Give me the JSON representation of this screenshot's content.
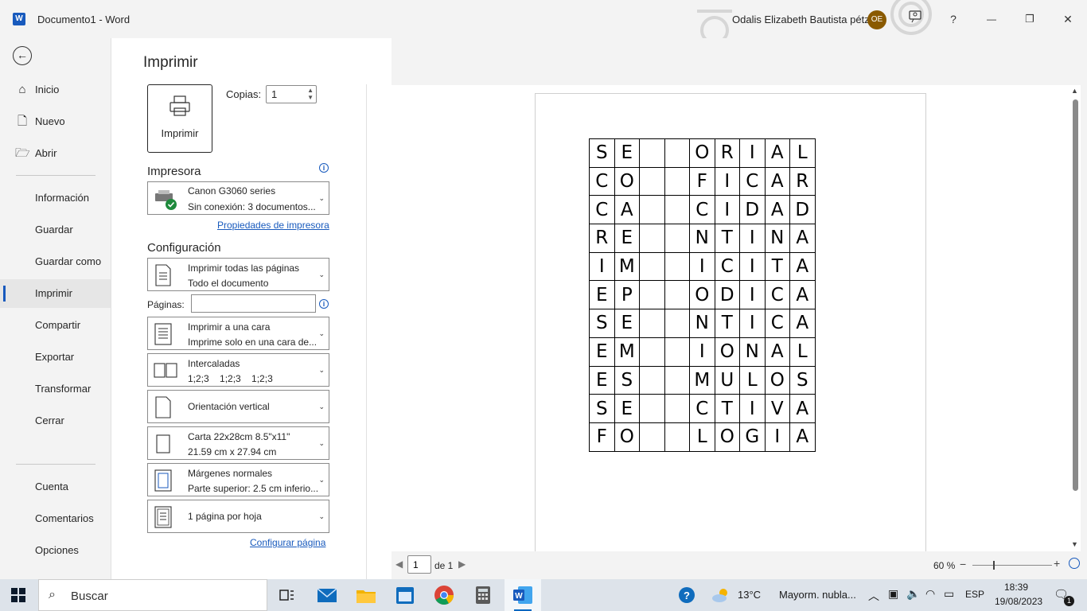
{
  "window": {
    "title": "Documento1  -  Word",
    "logo_letter": "W",
    "user_name": "Odalis Elizabeth   Bautista pétz",
    "user_initials": "OE",
    "help": "?",
    "minimize": "—",
    "restore": "❐",
    "close": "✕"
  },
  "nav": {
    "back": "←",
    "items": [
      {
        "label": "Inicio",
        "icon": "home-icon"
      },
      {
        "label": "Nuevo",
        "icon": "new-document-icon"
      },
      {
        "label": "Abrir",
        "icon": "folder-open-icon"
      },
      {
        "label": "Información"
      },
      {
        "label": "Guardar"
      },
      {
        "label": "Guardar como"
      },
      {
        "label": "Imprimir",
        "active": true
      },
      {
        "label": "Compartir"
      },
      {
        "label": "Exportar"
      },
      {
        "label": "Transformar"
      },
      {
        "label": "Cerrar"
      },
      {
        "label": "Cuenta"
      },
      {
        "label": "Comentarios"
      },
      {
        "label": "Opciones"
      }
    ]
  },
  "print": {
    "title": "Imprimir",
    "print_button": "Imprimir",
    "copies_label": "Copias:",
    "copies_value": "1",
    "printer_section": "Impresora",
    "printer_name": "Canon G3060 series",
    "printer_status": "Sin conexión: 3 documentos...",
    "printer_properties_link": "Propiedades de impresora",
    "settings_section": "Configuración",
    "pages_label": "Páginas:",
    "pages_value": "",
    "options": [
      {
        "line1": "Imprimir todas las páginas",
        "line2": "Todo el documento"
      },
      {
        "line1": "Imprimir a una cara",
        "line2": "Imprime solo en una cara de..."
      },
      {
        "line1": "Intercaladas",
        "line2": "1;2;3    1;2;3    1;2;3"
      },
      {
        "line1": "Orientación vertical",
        "line2": ""
      },
      {
        "line1": "Carta 22x28cm 8.5\"x11\"",
        "line2": "21.59 cm x 27.94 cm"
      },
      {
        "line1": "Márgenes normales",
        "line2": "Parte superior: 2.5 cm inferio..."
      },
      {
        "line1": "1 página por hoja",
        "line2": ""
      }
    ],
    "page_setup_link": "Configurar página"
  },
  "preview": {
    "grid": [
      [
        "S",
        "E",
        "",
        "",
        "O",
        "R",
        "I",
        "A",
        "L"
      ],
      [
        "C",
        "O",
        "",
        "",
        "F",
        "I",
        "C",
        "A",
        "R"
      ],
      [
        "C",
        "A",
        "",
        "",
        "C",
        "I",
        "D",
        "A",
        "D"
      ],
      [
        "R",
        "E",
        "",
        "",
        "N",
        "T",
        "I",
        "N",
        "A"
      ],
      [
        "I",
        "M",
        "",
        "",
        "I",
        "C",
        "I",
        "T",
        "A"
      ],
      [
        "E",
        "P",
        "",
        "",
        "O",
        "D",
        "I",
        "C",
        "A"
      ],
      [
        "S",
        "E",
        "",
        "",
        "N",
        "T",
        "I",
        "C",
        "A"
      ],
      [
        "E",
        "M",
        "",
        "",
        "I",
        "O",
        "N",
        "A",
        "L"
      ],
      [
        "E",
        "S",
        "",
        "",
        "M",
        "U",
        "L",
        "O",
        "S"
      ],
      [
        "S",
        "E",
        "",
        "",
        "C",
        "T",
        "I",
        "V",
        "A"
      ],
      [
        "F",
        "O",
        "",
        "",
        "L",
        "O",
        "G",
        "I",
        "A"
      ]
    ],
    "current_page": "1",
    "of_pages": "de 1",
    "zoom": "60 %",
    "zoom_level_percent": 60
  },
  "taskbar": {
    "search_placeholder": "Buscar",
    "weather_temp": "13°C",
    "weather_desc": "Mayorm. nubla...",
    "language": "ESP",
    "time": "18:39",
    "date": "19/08/2023",
    "notification_count": "1",
    "apps": [
      "task-view-icon",
      "mail-icon",
      "file-explorer-icon",
      "calendar-icon",
      "chrome-icon",
      "calculator-icon",
      "word-icon"
    ]
  },
  "colors": {
    "accent": "#185abd",
    "avatar": "#8a5a00"
  }
}
